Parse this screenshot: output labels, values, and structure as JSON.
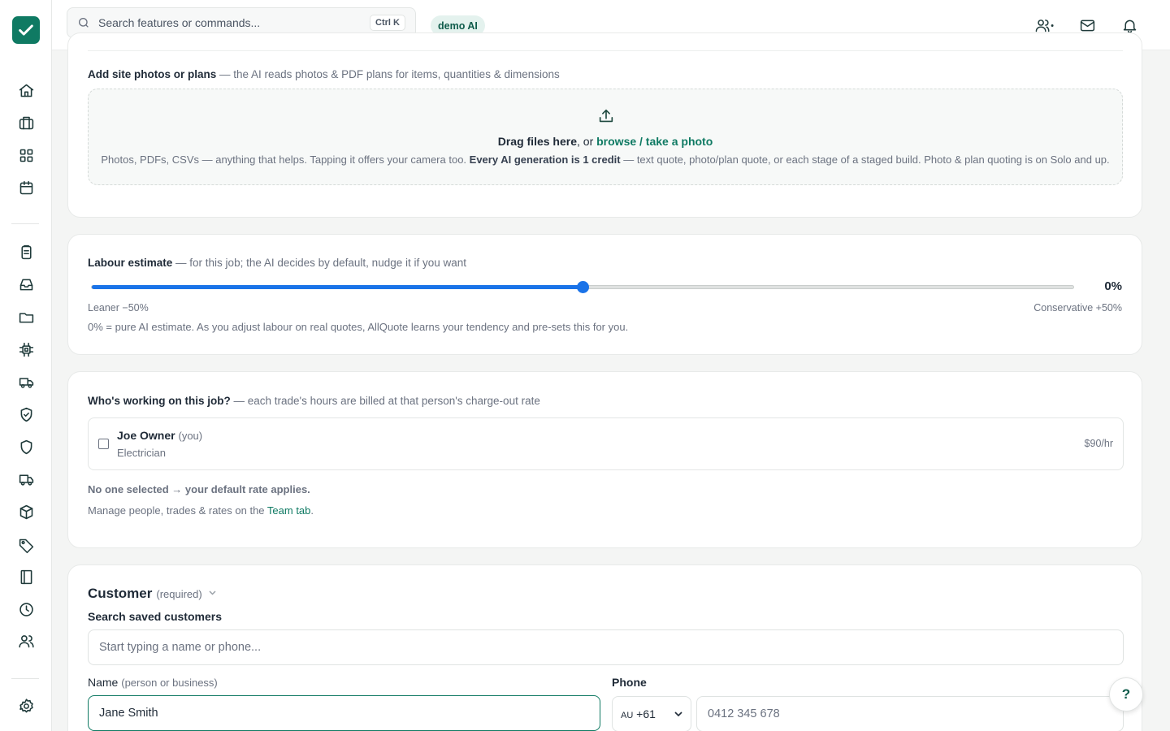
{
  "app": {
    "brand_color": "#0f7a63",
    "slider_color": "#1a73e8"
  },
  "topbar": {
    "search_placeholder": "Search features or commands...",
    "shortcut": "Ctrl K",
    "badge": "demo AI",
    "icons": [
      "team-switch-icon",
      "mail-icon",
      "bell-icon"
    ]
  },
  "sidebar": {
    "icons": [
      "home-icon",
      "briefcase-icon",
      "grid-icon",
      "calendar-icon",
      "clipboard-icon",
      "inbox-icon",
      "folder-icon",
      "chip-icon",
      "truck-icon",
      "shield-check-icon",
      "shield-icon",
      "delivery-truck-icon",
      "box-icon",
      "tag-icon",
      "book-icon",
      "clock-icon",
      "users-icon",
      "settings-icon"
    ]
  },
  "uploads": {
    "title": "Add site photos or plans",
    "subtitle": "— the AI reads photos & PDF plans for items, quantities & dimensions",
    "drop_title": "Drag files here",
    "drop_or": ", or ",
    "drop_link": "browse / take a photo",
    "desc_1": "Photos, PDFs, CSVs — anything that helps. Tapping it offers your camera too. ",
    "desc_bold": "Every AI generation is 1 credit",
    "desc_2": " — text quote, photo/plan quote, or each stage of a staged build. Photo & plan quoting is on Solo and up."
  },
  "labour": {
    "title": "Labour estimate",
    "subtitle": "— for this job; the AI decides by default, nudge it if you want",
    "value": "0%",
    "slider_fraction": 0.5,
    "min_label": "Leaner −50%",
    "max_label": "Conservative +50%",
    "note": "0% = pure AI estimate. As you adjust labour on real quotes, AllQuote learns your tendency and pre-sets this for you."
  },
  "workers": {
    "title": "Who's working on this job?",
    "subtitle": "— each trade's hours are billed at that person's charge-out rate",
    "person": {
      "name": "Joe Owner",
      "tag": "(you)",
      "role": "Electrician",
      "rate": "$90/hr",
      "checked": false
    },
    "none_selected": "No one selected → your default rate applies.",
    "manage_prefix": "Manage people, trades & rates on the ",
    "manage_link": "Team tab",
    "manage_suffix": "."
  },
  "customer": {
    "title": "Customer",
    "required": "(required)",
    "search_label": "Search saved customers",
    "search_placeholder": "Start typing a name or phone...",
    "name_label": "Name",
    "name_hint": "(person or business)",
    "name_value": "Jane Smith",
    "phone_label": "Phone",
    "country_code": "AU",
    "dial_code": "+61",
    "phone_placeholder": "0412 345 678"
  },
  "help": "?"
}
